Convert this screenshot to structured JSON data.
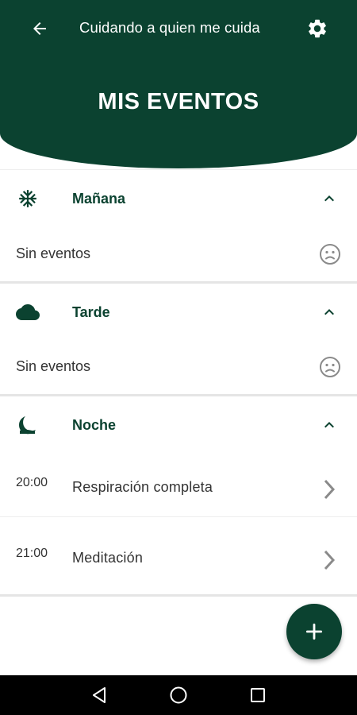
{
  "header": {
    "app_title": "Cuidando a quien me cuida",
    "page_title": "MIS EVENTOS",
    "back_icon": "arrow-left-icon",
    "settings_icon": "gear-icon"
  },
  "colors": {
    "primary": "#0b4230",
    "text": "#333333",
    "muted_icon": "#8a8a8a",
    "divider": "#e5e5e5"
  },
  "sections": [
    {
      "label": "Mañana",
      "icon": "snowflake-icon",
      "expanded": true,
      "empty_text": "Sin eventos",
      "empty_icon": "sad-face-icon"
    },
    {
      "label": "Tarde",
      "icon": "cloud-icon",
      "expanded": true,
      "empty_text": "Sin eventos",
      "empty_icon": "sad-face-icon"
    },
    {
      "label": "Noche",
      "icon": "moon-icon",
      "expanded": true,
      "events": [
        {
          "time": "20:00",
          "name": "Respiración completa"
        },
        {
          "time": "21:00",
          "name": "Meditación"
        }
      ]
    }
  ],
  "fab": {
    "icon": "plus-icon"
  },
  "android_nav": {
    "back_icon": "nav-back-triangle-icon",
    "home_icon": "nav-home-circle-icon",
    "recents_icon": "nav-recents-square-icon"
  }
}
